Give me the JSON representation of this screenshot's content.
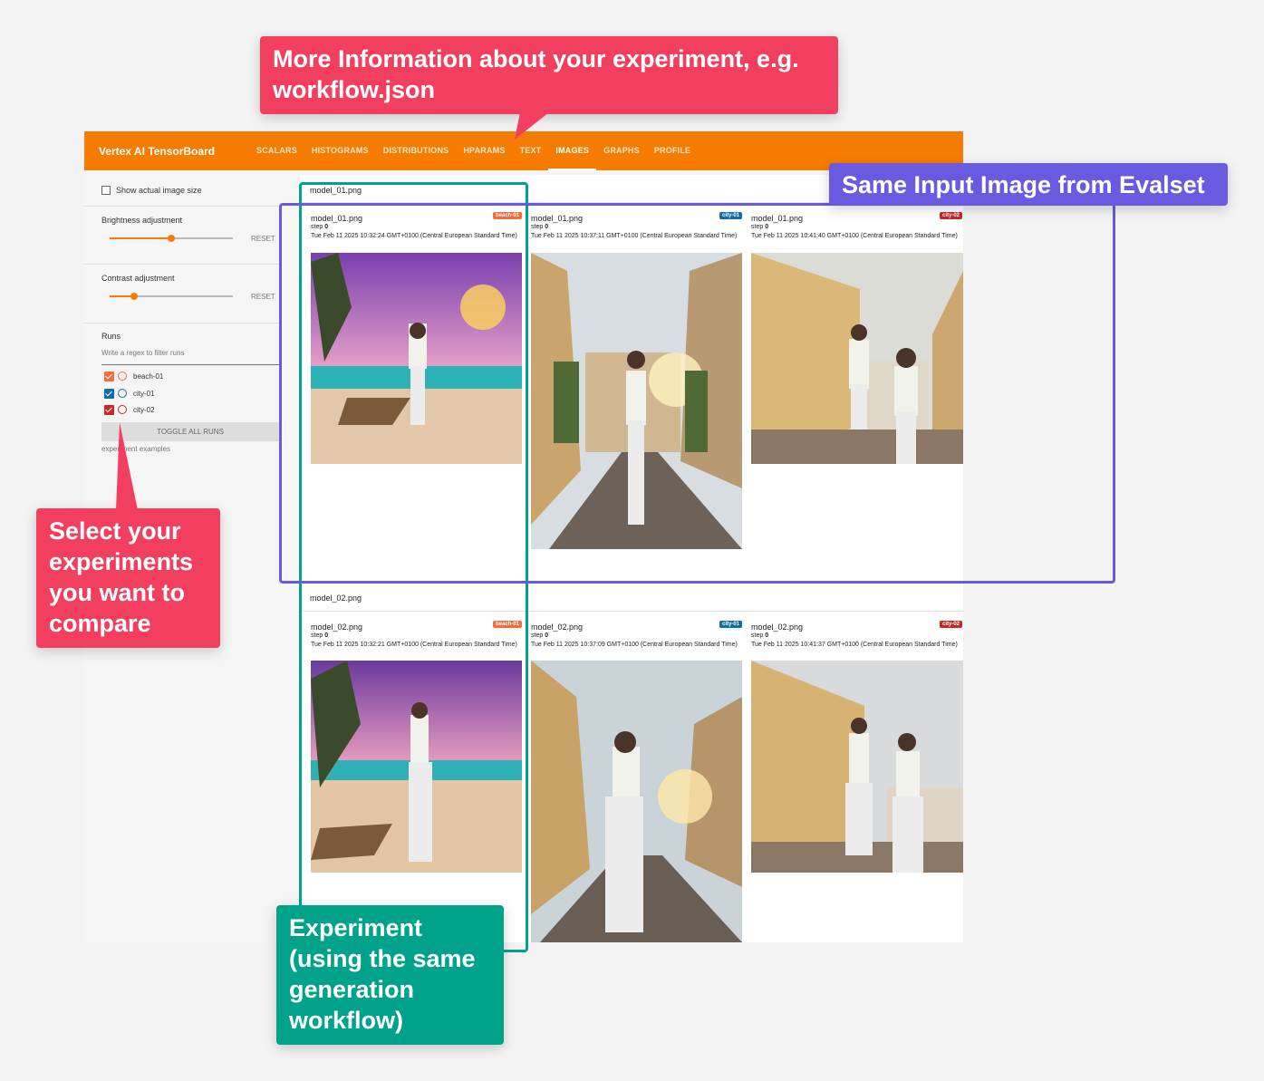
{
  "app": {
    "title": "Vertex AI TensorBoard",
    "tabs": [
      {
        "label": "SCALARS"
      },
      {
        "label": "HISTOGRAMS"
      },
      {
        "label": "DISTRIBUTIONS"
      },
      {
        "label": "HPARAMS"
      },
      {
        "label": "TEXT"
      },
      {
        "label": "IMAGES"
      },
      {
        "label": "GRAPHS"
      },
      {
        "label": "PROFILE"
      }
    ],
    "active_tab": "IMAGES",
    "accent": "#f57c00"
  },
  "sidebar": {
    "show_actual_size": "Show actual image size",
    "brightness": {
      "label": "Brightness adjustment",
      "reset": "RESET",
      "value": 0.5
    },
    "contrast": {
      "label": "Contrast adjustment",
      "reset": "RESET",
      "value": 0.2
    },
    "runs": {
      "title": "Runs",
      "filter_placeholder": "Write a regex to filter runs",
      "items": [
        {
          "name": "beach-01",
          "color": "#f26d3d",
          "checked": true
        },
        {
          "name": "city-01",
          "color": "#0f6ea6",
          "checked": true
        },
        {
          "name": "city-02",
          "color": "#c62828",
          "checked": true
        }
      ],
      "toggle_all": "TOGGLE ALL RUNS",
      "footer": "experiment examples"
    }
  },
  "main": {
    "groups": [
      {
        "title": "model_01.png",
        "cards": [
          {
            "file": "model_01.png",
            "step_label": "step",
            "step": "0",
            "time": "Tue Feb 11 2025 10:32:24 GMT+0100 (Central European Standard Time)",
            "run": "beach-01",
            "run_color": "#f26d3d"
          },
          {
            "file": "model_01.png",
            "step_label": "step",
            "step": "0",
            "time": "Tue Feb 11 2025 10:37:11 GMT+0100 (Central European Standard Time)",
            "run": "city-01",
            "run_color": "#0f6ea6"
          },
          {
            "file": "model_01.png",
            "step_label": "step",
            "step": "0",
            "time": "Tue Feb 11 2025 10:41:40 GMT+0100 (Central European Standard Time)",
            "run": "city-02",
            "run_color": "#c62828"
          }
        ]
      },
      {
        "title": "model_02.png",
        "cards": [
          {
            "file": "model_02.png",
            "step_label": "step",
            "step": "0",
            "time": "Tue Feb 11 2025 10:32:21 GMT+0100 (Central European Standard Time)",
            "run": "beach-01",
            "run_color": "#f26d3d"
          },
          {
            "file": "model_02.png",
            "step_label": "step",
            "step": "0",
            "time": "Tue Feb 11 2025 10:37:09 GMT+0100 (Central European Standard Time)",
            "run": "city-01",
            "run_color": "#0f6ea6"
          },
          {
            "file": "model_02.png",
            "step_label": "step",
            "step": "0",
            "time": "Tue Feb 11 2025 10:41:37 GMT+0100 (Central European Standard Time)",
            "run": "city-02",
            "run_color": "#c62828"
          }
        ]
      }
    ]
  },
  "annotations": {
    "info": "More Information about your experiment, e.g. workflow.json",
    "input_image": "Same Input Image from Evalset",
    "select": "Select your experiments you want to compare",
    "experiment": "Experiment (using the same generation workflow)",
    "colors": {
      "red": "#f23f5f",
      "purple": "#6a5ae0",
      "green": "#00a389"
    }
  }
}
